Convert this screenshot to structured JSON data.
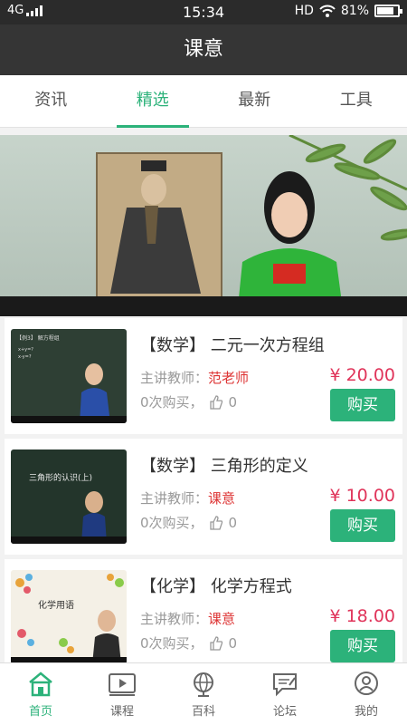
{
  "status_bar": {
    "network": "4G",
    "time": "15:34",
    "hd": "HD",
    "battery_percent": "81%",
    "battery_level": 0.81
  },
  "header": {
    "title": "课意"
  },
  "tabs": [
    {
      "label": "资讯",
      "active": false
    },
    {
      "label": "精选",
      "active": true
    },
    {
      "label": "最新",
      "active": false
    },
    {
      "label": "工具",
      "active": false
    }
  ],
  "courses": [
    {
      "title": "【数学】 二元一次方程组",
      "teacher_label": "主讲教师：",
      "teacher": "范老师",
      "purchases": "0次购买，",
      "likes": "0",
      "price": "¥ 20.00",
      "buy_label": "购买",
      "thumb_text": ""
    },
    {
      "title": "【数学】 三角形的定义",
      "teacher_label": "主讲教师：",
      "teacher": "课意",
      "purchases": "0次购买，",
      "likes": "0",
      "price": "¥ 10.00",
      "buy_label": "购买",
      "thumb_text": "三角形的认识(上)"
    },
    {
      "title": "【化学】 化学方程式",
      "teacher_label": "主讲教师：",
      "teacher": "课意",
      "purchases": "0次购买，",
      "likes": "0",
      "price": "¥ 18.00",
      "buy_label": "购买",
      "thumb_text": "化学用语"
    }
  ],
  "bottom_nav": [
    {
      "label": "首页",
      "icon": "home-icon",
      "active": true
    },
    {
      "label": "课程",
      "icon": "video-icon",
      "active": false
    },
    {
      "label": "百科",
      "icon": "globe-icon",
      "active": false
    },
    {
      "label": "论坛",
      "icon": "forum-icon",
      "active": false
    },
    {
      "label": "我的",
      "icon": "user-icon",
      "active": false
    }
  ],
  "colors": {
    "accent": "#2cb27a",
    "price": "#e0345a",
    "teacher_name": "#dd3333",
    "header_bg": "#353535"
  }
}
